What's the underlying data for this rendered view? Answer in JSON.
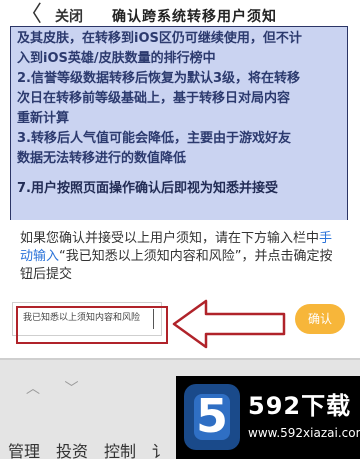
{
  "header": {
    "back_glyph": "〈",
    "close_label": "关闭",
    "title": "确认跨系统转移用户须知"
  },
  "notice": {
    "lines": [
      "及其皮肤，在转移到iOS区仍可继续使用，但不计",
      "入到iOS英雄/皮肤数量的排行榜中",
      "2.信誉等级数据转移后恢复为默认3级，将在转移",
      "次日在转移前等级基础上，基于转移日对局内容",
      "重新计算",
      "3.转移后人气值可能会降低，主要由于游戏好友",
      "数据无法转移进行的数值降低"
    ],
    "section_line": "7.用户按照页面操作确认后即视为知悉并接受"
  },
  "dialog": {
    "prompt_before": "如果您确认并接受以上用户须知，请在下方输入栏中",
    "prompt_link": "手动输入",
    "prompt_after": "“我已知悉以上须知内容和风险”，并点击确定按钮后提交",
    "input_value": "我已知悉以上须知内容和风险",
    "confirm_label": "确认"
  },
  "keyboard": {
    "arrows": "︿ ﹀",
    "items": [
      "管理",
      "投资",
      "控制",
      "讠"
    ]
  },
  "watermark": {
    "badge": "5",
    "main": "592下载",
    "url": "www.592xiazai.com"
  },
  "colors": {
    "accent_link": "#2b73d9",
    "confirm_button": "#f7b63a",
    "highlight": "#b0232a"
  }
}
